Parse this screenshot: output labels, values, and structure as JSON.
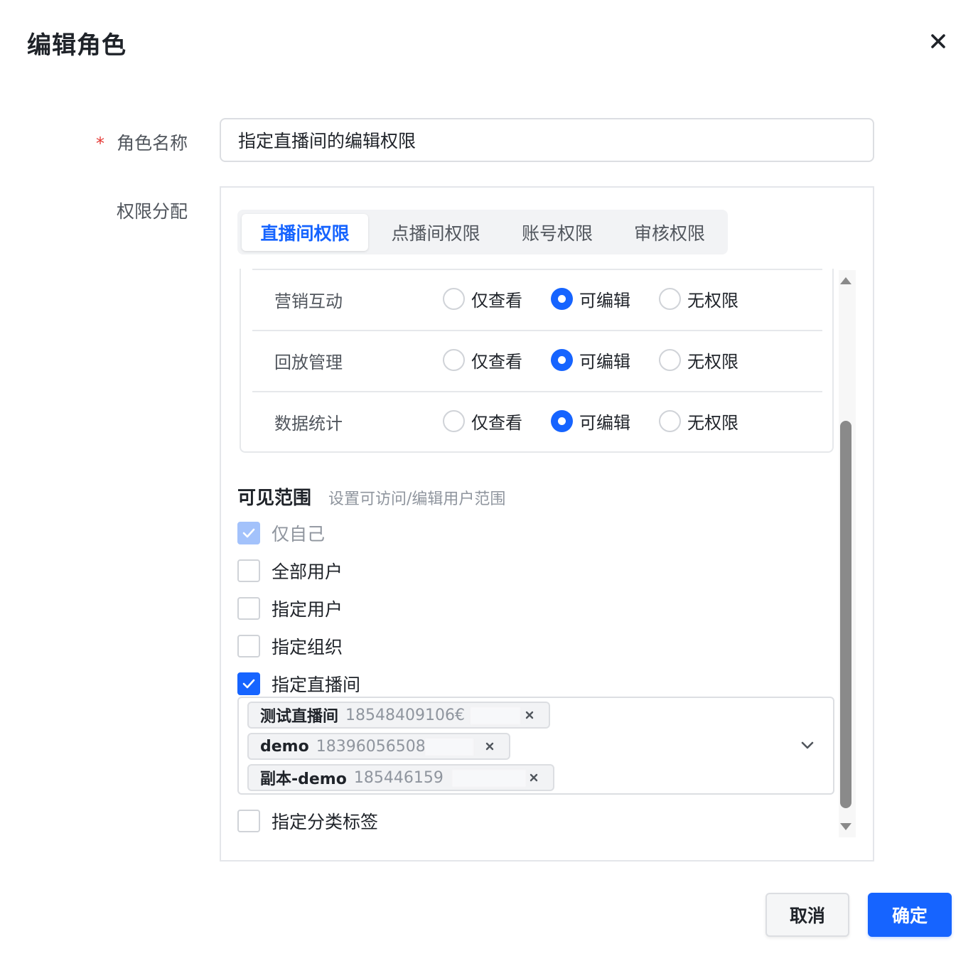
{
  "dialog": {
    "title": "编辑角色"
  },
  "form": {
    "role_name_label": "角色名称",
    "required_mark": "*",
    "role_name_value": "指定直播间的编辑权限",
    "permission_label": "权限分配"
  },
  "tabs": [
    {
      "label": "直播间权限",
      "active": true
    },
    {
      "label": "点播间权限",
      "active": false
    },
    {
      "label": "账号权限",
      "active": false
    },
    {
      "label": "审核权限",
      "active": false
    }
  ],
  "permission_rows": [
    {
      "label": "营销互动",
      "options": [
        "仅查看",
        "可编辑",
        "无权限"
      ],
      "selected": "可编辑"
    },
    {
      "label": "回放管理",
      "options": [
        "仅查看",
        "可编辑",
        "无权限"
      ],
      "selected": "可编辑"
    },
    {
      "label": "数据统计",
      "options": [
        "仅查看",
        "可编辑",
        "无权限"
      ],
      "selected": "可编辑"
    }
  ],
  "visibility": {
    "title": "可见范围",
    "subtitle": "设置可访问/编辑用户范围",
    "options": [
      {
        "label": "仅自己",
        "checked": true,
        "disabled": true
      },
      {
        "label": "全部用户",
        "checked": false,
        "disabled": false
      },
      {
        "label": "指定用户",
        "checked": false,
        "disabled": false
      },
      {
        "label": "指定组织",
        "checked": false,
        "disabled": false
      },
      {
        "label": "指定直播间",
        "checked": true,
        "disabled": false
      },
      {
        "label": "指定分类标签",
        "checked": false,
        "disabled": false
      }
    ],
    "selected_rooms": [
      {
        "name": "测试直播间",
        "id": "18548409106€"
      },
      {
        "name": "demo",
        "id": "18396056508"
      },
      {
        "name": "副本-demo",
        "id": "185446159"
      }
    ]
  },
  "footer": {
    "cancel_label": "取消",
    "confirm_label": "确定"
  },
  "colors": {
    "primary": "#1664ff",
    "required": "#e53935",
    "muted": "#8f959e"
  },
  "icons": {
    "close": "close-icon",
    "dropdown": "chevron-down-icon",
    "check": "check-icon",
    "tag_remove": "tag-close-icon"
  }
}
